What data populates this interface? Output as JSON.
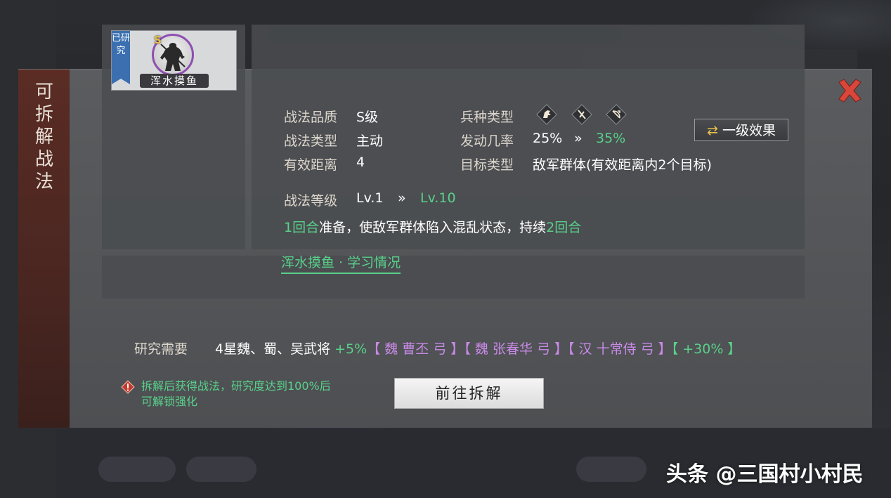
{
  "dialog": {
    "side_title": "可拆解战法",
    "card": {
      "tag": "已研究",
      "grade": "S",
      "name": "浑水摸鱼"
    },
    "info": {
      "quality_label": "战法品质",
      "quality_value": "S级",
      "type_label": "战法类型",
      "type_value": "主动",
      "range_label": "有效距离",
      "range_value": "4",
      "troop_label": "兵种类型",
      "rate_label": "发动几率",
      "rate_from": "25%",
      "rate_to": "35%",
      "target_label": "目标类型",
      "target_value": "敌军群体(有效距离内2个目标)",
      "level_label": "战法等级",
      "level_from": "Lv.1",
      "level_to": "Lv.10",
      "arrow": "»",
      "effect_button": "一级效果",
      "desc_part1": "1回合",
      "desc_part2": "准备，使敌军群体陷入混乱状态，持续",
      "desc_part3": "2回合",
      "learn_link": "浑水摸鱼 · 学习情况"
    },
    "requirement": {
      "label": "研究需要",
      "base": "4星魏、蜀、吴武将",
      "bonus": "+5%",
      "generals": "【 魏 曹丕 弓 】【 魏 张春华 弓 】【 汉 十常侍 弓 】",
      "total": "【 +30% 】"
    },
    "notice": {
      "line1": "拆解后获得战法，研究度达到100%后",
      "line2": "可解锁强化"
    },
    "go_button": "前往拆解"
  },
  "watermark": "头条 @三国村小村民",
  "colors": {
    "green": "#59d18a",
    "purple": "#c88ae6",
    "close_red": "#d9463a",
    "side_red": "#5a2c24"
  }
}
